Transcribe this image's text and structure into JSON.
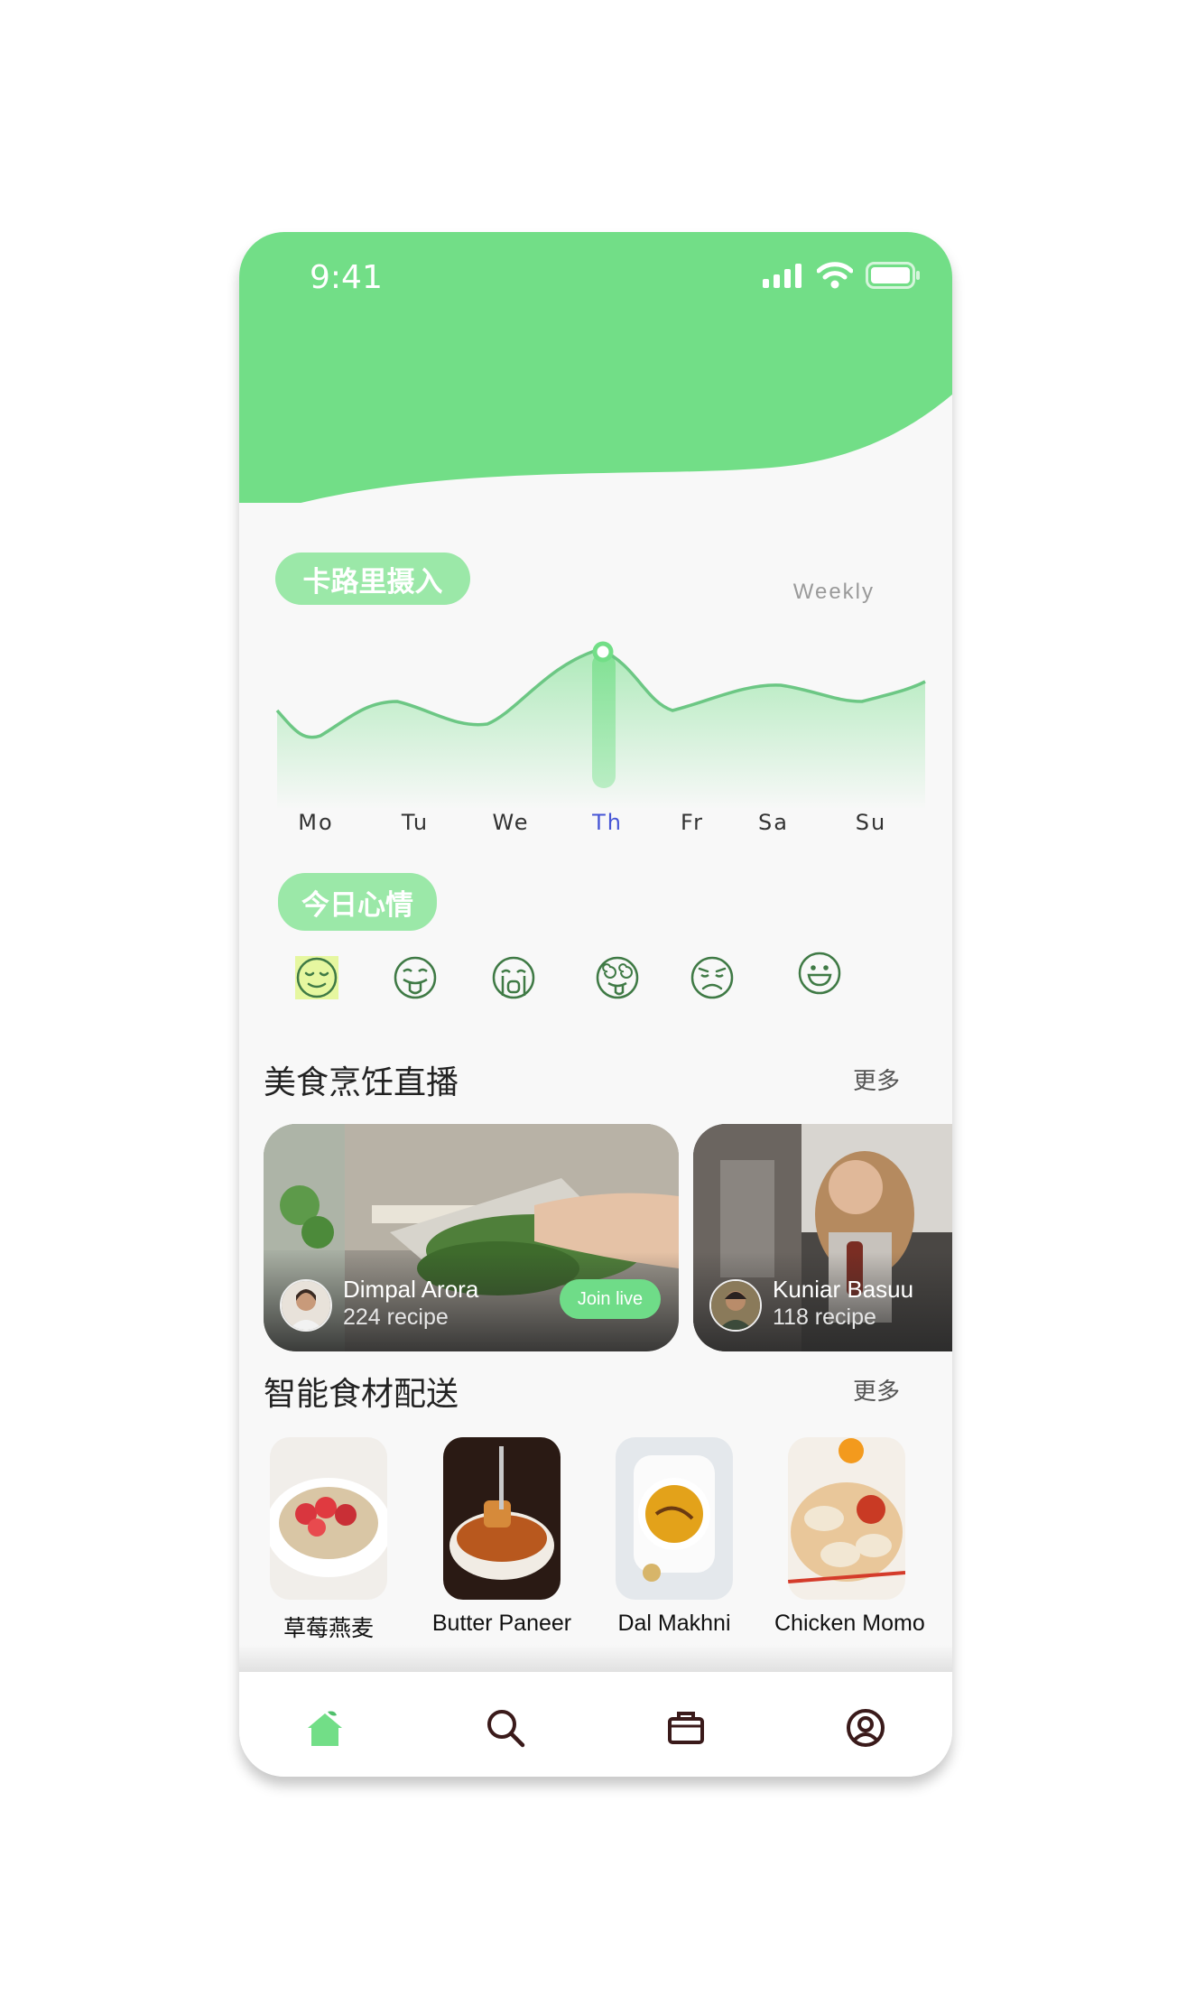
{
  "status_bar": {
    "time": "9:41"
  },
  "calorie": {
    "title": "卡路里摄入",
    "period": "Weekly",
    "active_day": "Th"
  },
  "days": [
    "Mo",
    "Tu",
    "We",
    "Th",
    "Fr",
    "Sa",
    "Su"
  ],
  "mood": {
    "title": "今日心情",
    "faces": [
      "smiling-relieved-face-icon",
      "tongue-out-face-icon",
      "crying-face-icon",
      "dizzy-face-icon",
      "frowning-face-icon",
      "grinning-face-icon"
    ],
    "selected": "smiling-relieved-face-icon"
  },
  "live": {
    "title": "美食烹饪直播",
    "more": "更多",
    "cards": [
      {
        "name": "Dimpal Arora",
        "count": "224 recipe",
        "button": "Join live"
      },
      {
        "name": "Kuniar Basuu",
        "count": "118 recipe"
      }
    ]
  },
  "delivery": {
    "title": "智能食材配送",
    "more": "更多",
    "items": [
      {
        "name": "草莓燕麦"
      },
      {
        "name": "Butter Paneer"
      },
      {
        "name": "Dal Makhni"
      },
      {
        "name": "Chicken Momo"
      }
    ]
  },
  "tabs": [
    "home-icon",
    "search-icon",
    "briefcase-icon",
    "profile-icon"
  ],
  "colors": {
    "brand_green": "#72de87",
    "pill_green": "#9be8a8",
    "active_day": "#4756d6",
    "icon_dark": "#3a1a1a"
  }
}
